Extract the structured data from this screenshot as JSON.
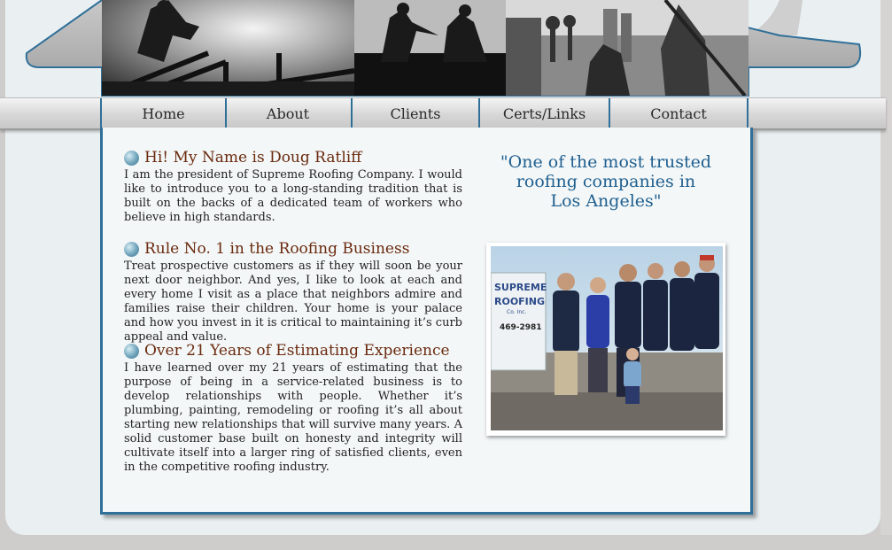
{
  "nav": {
    "items": [
      "Home",
      "About",
      "Clients",
      "Certs/Links",
      "Contact"
    ]
  },
  "sections": [
    {
      "title": "Hi! My Name is Doug Ratliff",
      "body": "I am the president of Supreme Roofing Company. I would like to introduce you to a long-standing tradition that is built on the backs of a dedicated team of workers who believe in high standards."
    },
    {
      "title": "Rule No. 1 in the Roofing Business",
      "body": "Treat prospective customers as if they will soon be your next door neighbor. And yes, I like to look at each and every home I visit as a place that neighbors admire and families raise their children. Your home is your palace and how you invest in it is critical to maintaining it’s curb appeal and value."
    },
    {
      "title": "Over 21 Years of Estimating Experience",
      "body": "I have learned over my 21 years of estimating that the purpose of being in a service-related business is to develop relationships with people. Whether it’s plumbing, painting, remodeling or roofing it’s all about starting new relationships that will survive many years. A solid customer base built on honesty and integrity will cultivate itself into a larger ring of satisfied clients, even in the competitive roofing industry."
    }
  ],
  "quote": {
    "line1": "\"One of the most trusted",
    "line2": "roofing companies in",
    "line3": "Los Angeles\""
  },
  "team_photo": {
    "sign_line1": "SUPREME",
    "sign_line2": "ROOFING",
    "sign_line3": "Co. Inc.",
    "sign_line4": "469-2981"
  },
  "colors": {
    "accent_blue": "#2f6f98",
    "heading_brown": "#6b2a0e",
    "quote_blue": "#1f5f8f",
    "roof_gray": "#a9a9a9"
  },
  "icons": {
    "bullet": "blue-sphere-bullet-icon"
  }
}
